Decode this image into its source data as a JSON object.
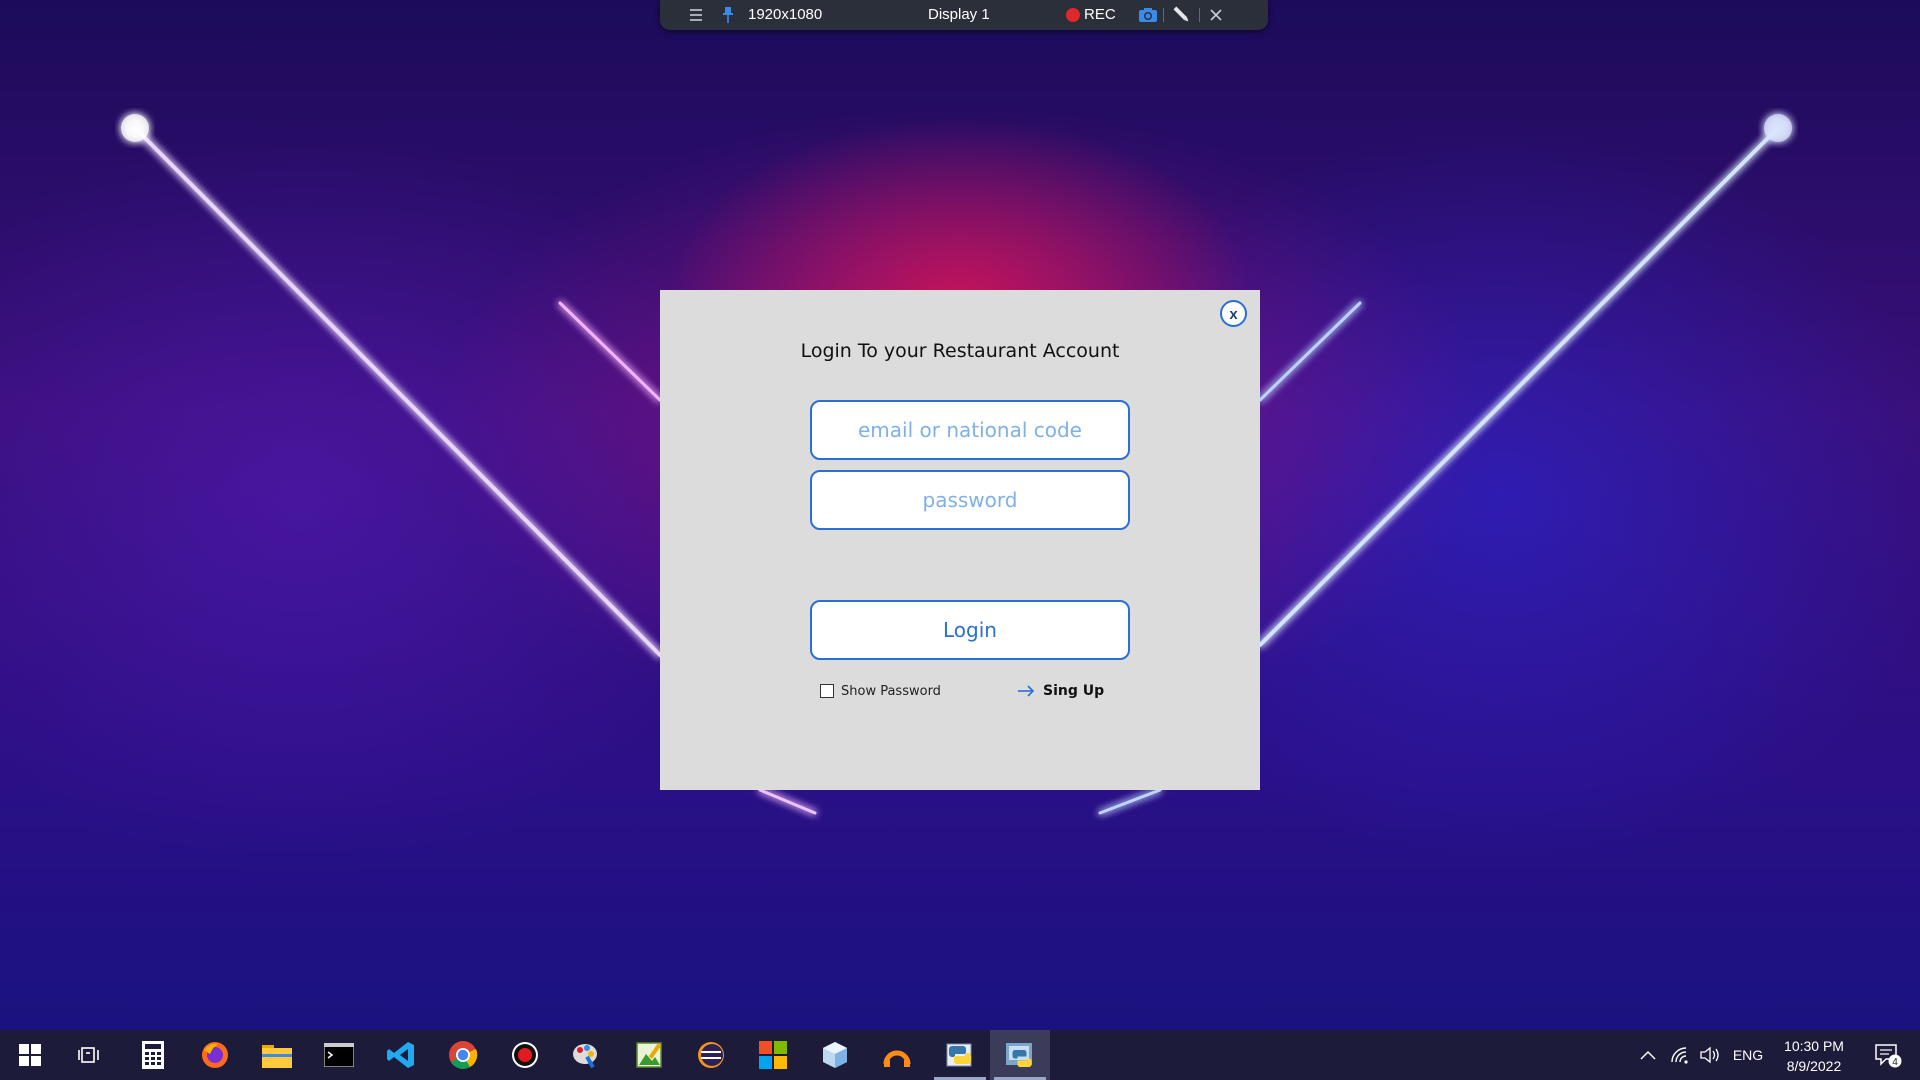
{
  "remote_bar": {
    "menu_icon": "hamburger-icon",
    "pin_icon": "pin-icon",
    "resolution": "1920x1080",
    "display": "Display 1",
    "rec_label": "REC",
    "rec_color": "#e0272b",
    "camera_icon": "camera-icon",
    "pen_icon": "pen-icon",
    "close_icon": "close-icon"
  },
  "dialog": {
    "close_label": "x",
    "title": "Login To your Restaurant Account",
    "email_placeholder": "email or national code",
    "password_placeholder": "password",
    "login_label": "Login",
    "show_password_label": "Show Password",
    "show_password_checked": false,
    "signup_label": "Sing Up",
    "accent_color": "#2a6fd6",
    "background_color": "#dcdcdc"
  },
  "taskbar": {
    "apps": [
      {
        "icon": "windows-start-icon"
      },
      {
        "icon": "task-view-icon"
      },
      {
        "icon": "calculator-icon"
      },
      {
        "icon": "firefox-icon"
      },
      {
        "icon": "file-explorer-icon"
      },
      {
        "icon": "terminal-icon"
      },
      {
        "icon": "vscode-icon"
      },
      {
        "icon": "chrome-icon"
      },
      {
        "icon": "record-icon"
      },
      {
        "icon": "paint-icon"
      },
      {
        "icon": "image-editor-icon"
      },
      {
        "icon": "eclipse-icon"
      },
      {
        "icon": "store-icon"
      },
      {
        "icon": "virtualbox-icon"
      },
      {
        "icon": "orange-app-icon"
      },
      {
        "icon": "python-idle-icon"
      },
      {
        "icon": "python-app-icon"
      }
    ],
    "tray": {
      "chevron_icon": "chevron-up-icon",
      "network_icon": "network-icon",
      "volume_icon": "volume-icon",
      "language": "ENG",
      "time": "10:30 PM",
      "date": "8/9/2022",
      "notification_icon": "notification-icon",
      "notification_count": "4"
    }
  }
}
